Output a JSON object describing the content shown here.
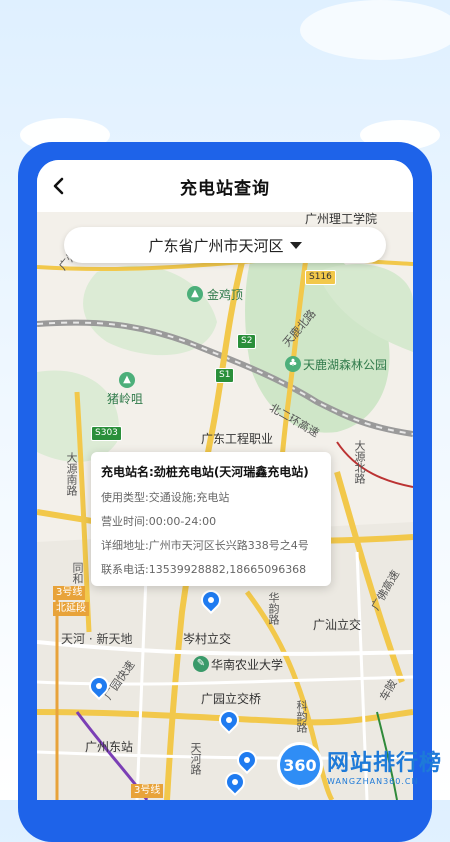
{
  "header": {
    "title": "充电站查询",
    "back_icon": "chevron-left-icon"
  },
  "region_select": {
    "value": "广东省广州市天河区",
    "icon": "caret-down-icon"
  },
  "station_card": {
    "name_label": "充电站名:",
    "name_value": "劲桩充电站(天河瑞鑫充电站)",
    "type_label": "使用类型:",
    "type_value": "交通设施;充电站",
    "hours_label": "营业时间:",
    "hours_value": "00:00-24:00",
    "address_label": "详细地址:",
    "address_value": "广州市天河区长兴路338号之4号",
    "phone_label": "联系电话:",
    "phone_value": "13539928882,18665096368"
  },
  "map_labels": {
    "top_school": "广州理工学院",
    "jinjiding": "金鸡顶",
    "tianlu_north": "天鹿北路",
    "s2": "S2",
    "s1": "S1",
    "s303": "S303",
    "s116": "S116",
    "tianlu_park": "天鹿湖森林公园",
    "zhulingju": "猪岭咀",
    "guangdong_eng": "广东工程职业",
    "dayuan_south": "大源南路",
    "dayuan_north": "大源北路",
    "north_ring": "北二环高速",
    "tonghe": "同和",
    "guangfo": "广佛高速",
    "line3": "3号线",
    "line3_ext": "北延段",
    "tianhe_xintiandi": "天河 · 新天地",
    "cencun": "岑村立交",
    "guangshan": "广汕立交",
    "huanong": "华南农业大学",
    "guangyuan_bridge": "广园立交桥",
    "guangzhou_east": "广州东站",
    "guangyuan_express": "广园快速",
    "huahui": "华韵路",
    "kehua": "科韵路",
    "tianhe_road": "天河路",
    "dongxi": "车陂",
    "line3b": "3号线",
    "guangzhou_word": "广州"
  },
  "watermark": {
    "logo": "360",
    "title": "网站排行榜",
    "sub": "WANGZHAN360.CN"
  }
}
